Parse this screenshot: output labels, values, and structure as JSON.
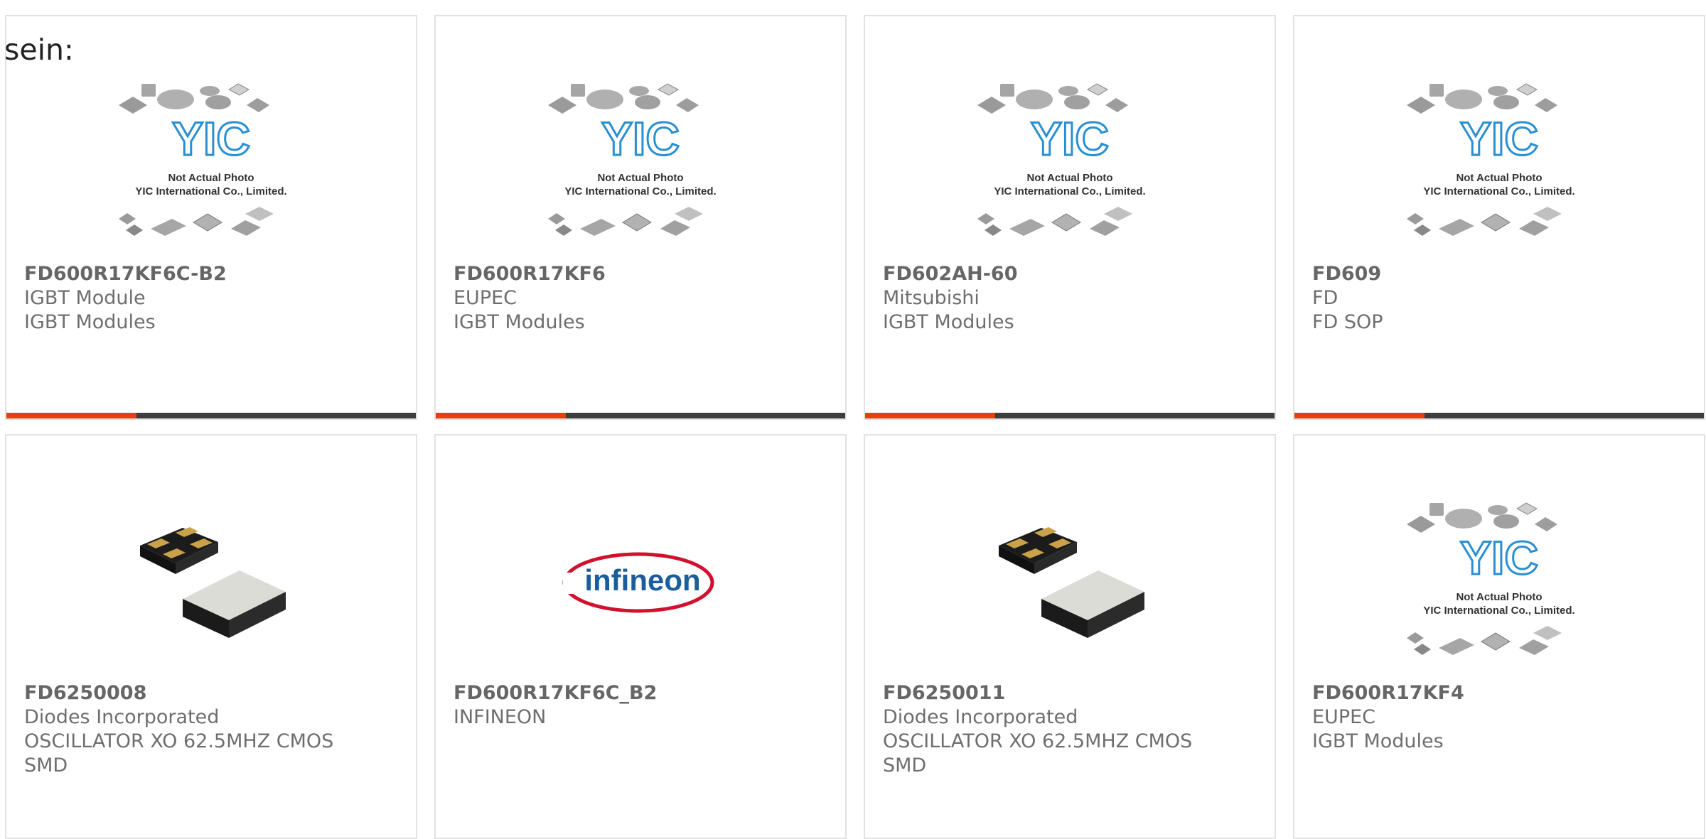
{
  "lead_text": "sein:",
  "placeholder_caption": {
    "line1": "Not Actual Photo",
    "line2": "YIC International Co., Limited.",
    "logo": "YIC"
  },
  "brand_logo_text": "infineon",
  "colors": {
    "card_border": "#e2e2e2",
    "accent_bar": "#e8400c",
    "dark_bar": "#3d3d3d",
    "logo_blue": "#2a8fd0"
  },
  "products": [
    {
      "part": "FD600R17KF6C-B2",
      "maker": "IGBT Module",
      "desc": "IGBT Modules",
      "image": "yic-placeholder"
    },
    {
      "part": "FD600R17KF6",
      "maker": "EUPEC",
      "desc": "IGBT Modules",
      "image": "yic-placeholder"
    },
    {
      "part": "FD602AH-60",
      "maker": "Mitsubishi",
      "desc": "IGBT Modules",
      "image": "yic-placeholder"
    },
    {
      "part": "FD609",
      "maker": "FD",
      "desc": "FD SOP",
      "image": "yic-placeholder"
    },
    {
      "part": "FD6250008",
      "maker": "Diodes Incorporated",
      "desc": "OSCILLATOR XO 62.5MHZ CMOS",
      "desc2": "SMD",
      "image": "oscillator-photo"
    },
    {
      "part": "FD600R17KF6C_B2",
      "maker": "INFINEON",
      "desc": "",
      "image": "infineon-logo"
    },
    {
      "part": "FD6250011",
      "maker": "Diodes Incorporated",
      "desc": "OSCILLATOR XO 62.5MHZ CMOS",
      "desc2": "SMD",
      "image": "oscillator-photo"
    },
    {
      "part": "FD600R17KF4",
      "maker": "EUPEC",
      "desc": "IGBT Modules",
      "image": "yic-placeholder"
    }
  ]
}
